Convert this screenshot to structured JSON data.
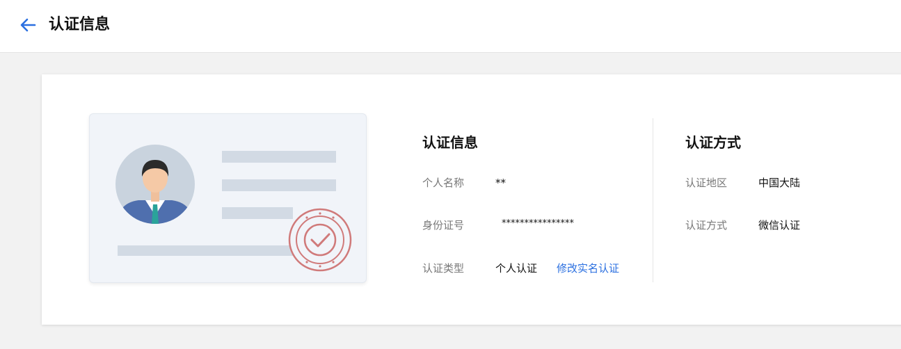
{
  "header": {
    "back_icon": "arrow-left-icon",
    "title": "认证信息",
    "accent_color": "#2a6fe0"
  },
  "info": {
    "title": "认证信息",
    "rows": [
      {
        "label": "个人名称",
        "value": "**"
      },
      {
        "label": "身份证号",
        "value": "****************"
      },
      {
        "label": "认证类型",
        "value": "个人认证"
      }
    ],
    "modify_link": "修改实名认证"
  },
  "method": {
    "title": "认证方式",
    "rows": [
      {
        "label": "认证地区",
        "value": "中国大陆"
      },
      {
        "label": "认证方式",
        "value": "微信认证"
      }
    ]
  },
  "illustration": {
    "icons": [
      "id-card-illustration",
      "user-avatar-icon",
      "certified-seal-icon"
    ]
  }
}
